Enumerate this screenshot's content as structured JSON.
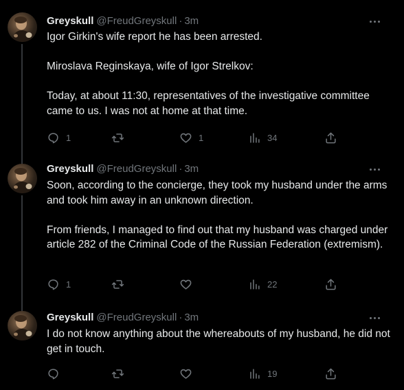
{
  "thread": {
    "tweets": [
      {
        "display_name": "Greyskull",
        "handle": "@FreudGreyskull",
        "separator": "·",
        "time": "3m",
        "paragraphs": [
          "Igor Girkin's wife report he has been arrested.",
          "Miroslava Reginskaya, wife of Igor Strelkov:",
          "Today, at about 11:30, representatives of the investigative committee came to us. I was not at home at that time."
        ],
        "stats": {
          "replies": "1",
          "retweets": "",
          "likes": "1",
          "views": "34"
        }
      },
      {
        "display_name": "Greyskull",
        "handle": "@FreudGreyskull",
        "separator": "·",
        "time": "3m",
        "paragraphs": [
          "Soon, according to the concierge, they took my husband under the arms and took him away in an unknown direction.",
          "From friends, I managed to find out that my husband was charged under article 282 of the Criminal Code of the Russian Federation (extremism)."
        ],
        "stats": {
          "replies": "1",
          "retweets": "",
          "likes": "",
          "views": "22"
        }
      },
      {
        "display_name": "Greyskull",
        "handle": "@FreudGreyskull",
        "separator": "·",
        "time": "3m",
        "paragraphs": [
          "I do not know anything about the whereabouts of my husband, he did not get in touch."
        ],
        "stats": {
          "replies": "",
          "retweets": "",
          "likes": "",
          "views": "19"
        }
      }
    ]
  },
  "icons": {
    "more": "more-icon",
    "reply": "reply-icon",
    "retweet": "retweet-icon",
    "like": "like-icon",
    "views": "views-icon",
    "share": "share-icon"
  },
  "colors": {
    "background": "#000000",
    "primary_text": "#e7e9ea",
    "secondary_text": "#71767b",
    "thread_line": "#333639"
  }
}
